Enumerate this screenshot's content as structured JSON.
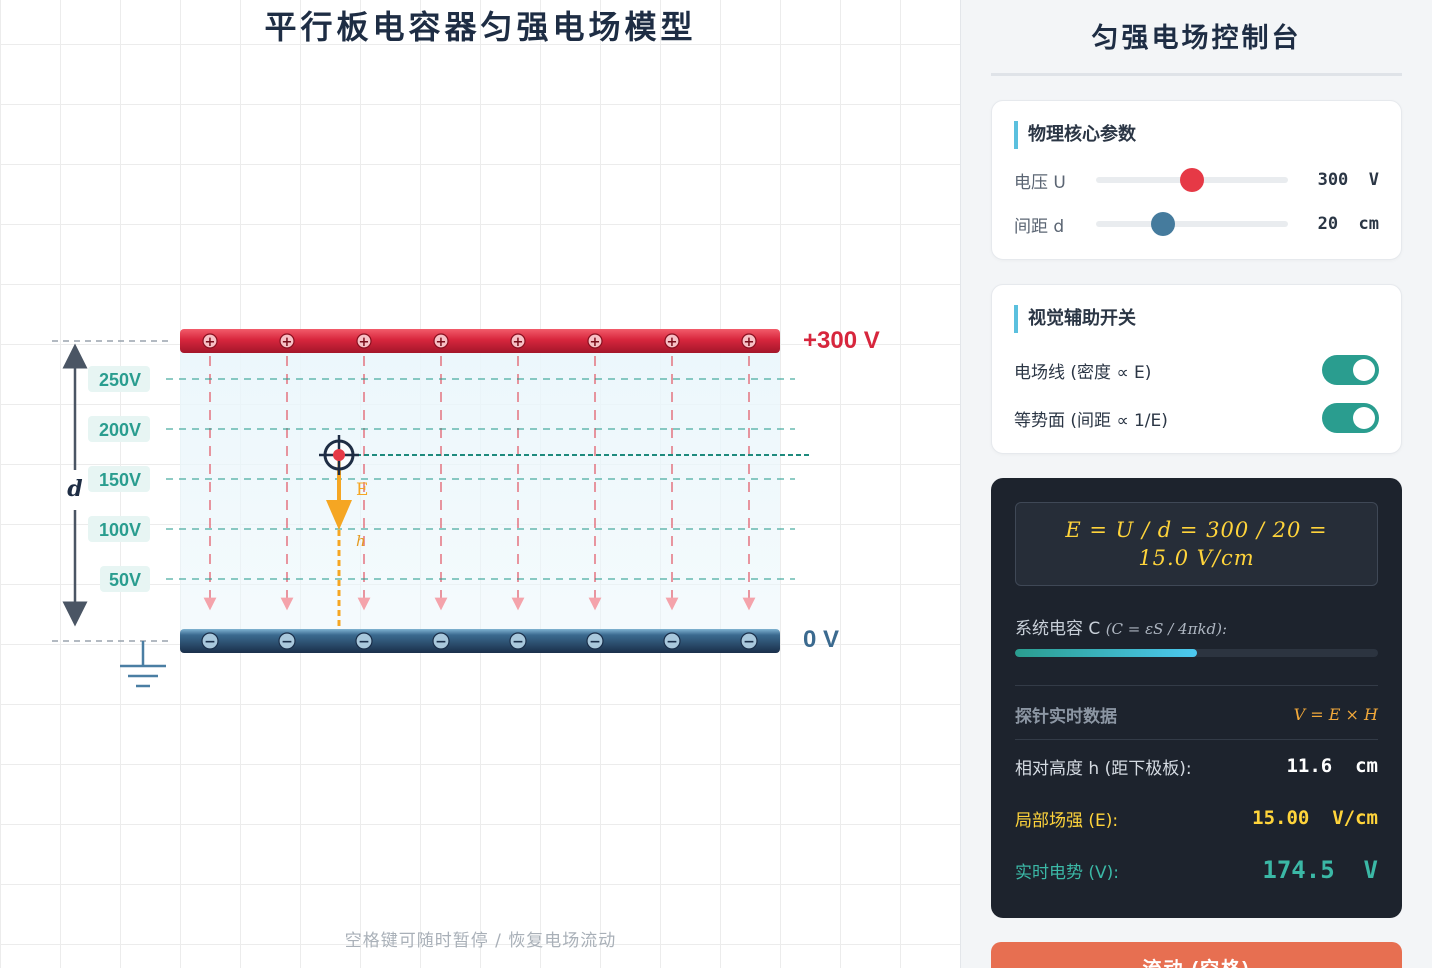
{
  "stage": {
    "title": "平行板电容器匀强电场模型",
    "hint": "空格键可随时暂停 / 恢复电场流动",
    "top_plate_label": "+300 V",
    "bottom_plate_label": "0 V",
    "distance_label": "d",
    "field_label": "E",
    "height_label": "h",
    "equipotentials": [
      "250V",
      "200V",
      "150V",
      "100V",
      "50V"
    ],
    "plus_sign": "+",
    "minus_sign": "−"
  },
  "panel": {
    "title": "匀强电场控制台",
    "params": {
      "heading": "物理核心参数",
      "voltage_label": "电压 U",
      "voltage_value": "300  V",
      "voltage_level": 0.5,
      "distance_label": "间距 d",
      "distance_value": "20  cm",
      "distance_level": 0.35
    },
    "toggles": {
      "heading": "视觉辅助开关",
      "field_lines_label": "电场线 (密度 ∝ E)",
      "field_lines_on": true,
      "equipotential_label": "等势面 (间距 ∝ 1/E)",
      "equipotential_on": true
    },
    "readout": {
      "formula": "E = U / d = 300 / 20 = 15.0 V/cm",
      "capacitance_label": "系统电容 C",
      "capacitance_formula": "(C = εS / 4πkd):",
      "capacitance_level": 0.5,
      "probe_heading": "探针实时数据",
      "probe_formula": "V = E × H",
      "height_label": "相对高度 h (距下极板):",
      "height_value": "11.6  cm",
      "field_label": "局部场强 (E):",
      "field_value": "15.00  V/cm",
      "potential_label": "实时电势 (V):",
      "potential_value": "174.5  V"
    },
    "run_button": "流动 (空格)"
  },
  "colors": {
    "positive": "#d7263d",
    "negative": "#1f3b5a",
    "equipotential": "#2a9d8f",
    "field_line": "#e05260",
    "probe_arrow": "#f5a623",
    "voltage_knob": "#e63946",
    "distance_knob": "#457b9d",
    "run_button": "#e76f51"
  }
}
